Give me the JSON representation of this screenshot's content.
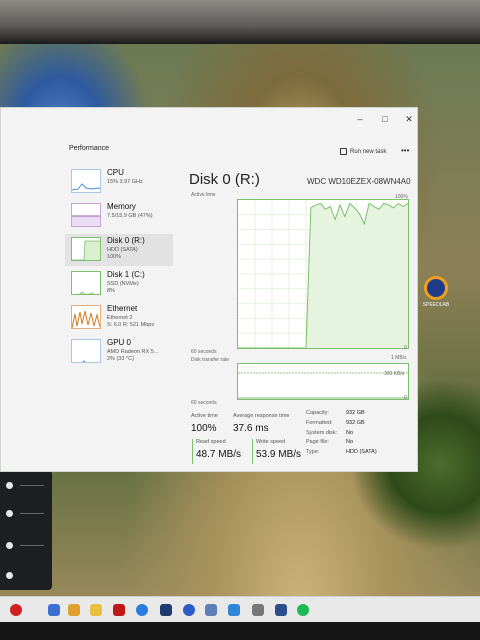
{
  "window": {
    "sidebar_heading": "Performance",
    "run_new_task": "Run new task",
    "more": "•••",
    "minimize": "–",
    "maximize": "□",
    "close": "✕"
  },
  "sidebar": {
    "items": [
      {
        "name": "CPU",
        "line1": "15% 3.97 GHz",
        "line2": ""
      },
      {
        "name": "Memory",
        "line1": "7.5/15.9 GB (47%)",
        "line2": ""
      },
      {
        "name": "Disk 0 (R:)",
        "line1": "HDD (SATA)",
        "line2": "100%"
      },
      {
        "name": "Disk 1 (C:)",
        "line1": "SSD (NVMe)",
        "line2": "8%"
      },
      {
        "name": "Ethernet",
        "line1": "Ethernet 2",
        "line2": "S: 6.0 R: 521 Mbps"
      },
      {
        "name": "GPU 0",
        "line1": "AMD Radeon RX 5...",
        "line2": "2% (33 °C)"
      }
    ]
  },
  "main": {
    "title": "Disk 0 (R:)",
    "model": "WDC WD10EZEX-08WN4A0",
    "active_time_label": "Active time",
    "active_time_max": "100%",
    "graph1_time": "60 seconds",
    "graph1_min": "0",
    "transfer_label": "Disk transfer rate",
    "transfer_max": "1 MB/s",
    "transfer_mid": "300 KB/s",
    "graph2_time": "60 seconds",
    "graph2_min": "0",
    "stats": {
      "active_time_label": "Active time",
      "active_time_value": "100%",
      "response_label": "Average response time",
      "response_value": "37.6 ms",
      "read_label": "Read speed",
      "read_value": "48.7 MB/s",
      "write_label": "Write speed",
      "write_value": "53.9 MB/s"
    },
    "details": [
      {
        "key": "Capacity:",
        "value": "932 GB"
      },
      {
        "key": "Formatted:",
        "value": "932 GB"
      },
      {
        "key": "System disk:",
        "value": "No"
      },
      {
        "key": "Page file:",
        "value": "No"
      },
      {
        "key": "Type:",
        "value": "HDD (SATA)"
      }
    ]
  },
  "desktop": {
    "icon_label": "SPEEDLAB"
  },
  "colors": {
    "disk_green": "#7dbf6d",
    "disk_fill": "#e6f4df",
    "cpu_blue": "#4a90d9",
    "memory_purple": "#9b59b6",
    "ethernet_orange": "#d47a1e"
  },
  "chart_data": {
    "type": "area",
    "title": "Active time",
    "ylim": [
      0,
      100
    ],
    "y_unit": "%",
    "x_span_seconds": 60,
    "values": [
      0,
      0,
      0,
      0,
      0,
      0,
      0,
      0,
      0,
      0,
      0,
      0,
      0,
      0,
      0,
      96,
      98,
      99,
      95,
      97,
      88,
      98,
      90,
      99,
      96,
      92,
      85,
      99,
      97,
      95,
      99,
      98,
      96,
      99,
      97,
      99
    ]
  }
}
